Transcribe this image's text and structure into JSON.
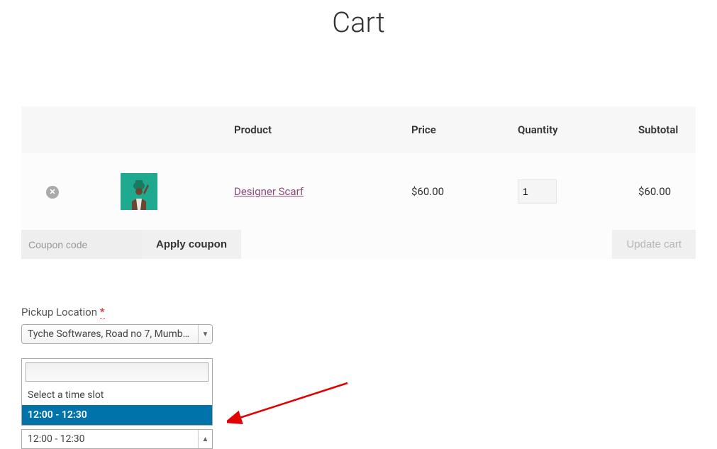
{
  "page": {
    "title": "Cart"
  },
  "columns": {
    "product": "Product",
    "price": "Price",
    "quantity": "Quantity",
    "subtotal": "Subtotal"
  },
  "item": {
    "name": "Designer Scarf",
    "price": "$60.00",
    "quantity": "1",
    "subtotal": "$60.00"
  },
  "coupon": {
    "placeholder": "Coupon code",
    "apply_label": "Apply coupon"
  },
  "update": {
    "label": "Update cart"
  },
  "pickup": {
    "label": "Pickup Location ",
    "required": "*",
    "selected": "Tyche Softwares, Road no 7, Mumbai, …"
  },
  "timeslot": {
    "placeholder_option": "Select a time slot",
    "highlighted_option": "12:00 - 12:30",
    "selected_value": "12:00 - 12:30"
  }
}
